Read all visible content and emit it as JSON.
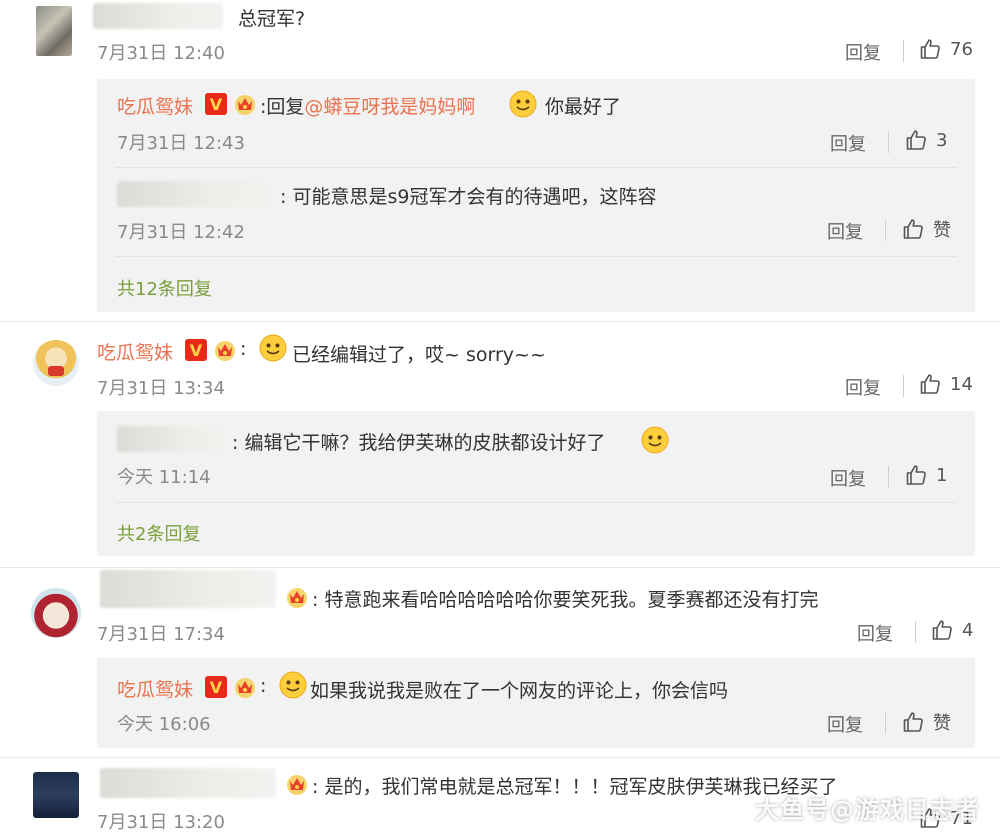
{
  "comments": [
    {
      "text": "总冠军?",
      "time": "7月31日 12:40",
      "reply_label": "回复",
      "likes": "76"
    },
    {
      "user": "吃瓜鸳妹",
      "text": "已经编辑过了，哎~ sorry~~",
      "time": "7月31日 13:34",
      "reply_label": "回复",
      "likes": "14"
    },
    {
      "text": "特意跑来看哈哈哈哈哈哈你要笑死我。夏季赛都还没有打完",
      "time": "7月31日 17:34",
      "reply_label": "回复",
      "likes": "4"
    },
    {
      "text": "是的，我们常电就是总冠军！！！冠军皮肤伊芙琳我已经买了",
      "time": "7月31日 13:20",
      "likes": "71"
    }
  ],
  "replies": [
    {
      "user": "吃瓜鸳妹",
      "text_prefix": "回复",
      "mention": "@蟒豆呀我是妈妈啊",
      "text_suffix": "你最好了",
      "time": "7月31日 12:43",
      "reply_label": "回复",
      "likes": "3"
    },
    {
      "text": "可能意思是s9冠军才会有的待遇吧，这阵容",
      "time": "7月31日 12:42",
      "reply_label": "回复",
      "likes": "赞"
    },
    {
      "text": "编辑它干嘛？我给伊芙琳的皮肤都设计好了",
      "time": "今天 11:14",
      "reply_label": "回复",
      "likes": "1"
    },
    {
      "user": "吃瓜鸳妹",
      "text": "如果我说我是败在了一个网友的评论上，你会信吗",
      "time": "今天 16:06",
      "reply_label": "回复",
      "likes": "赞"
    }
  ],
  "more_replies": [
    "共12条回复",
    "共2条回复"
  ],
  "badges": {
    "verified_letter": "V",
    "colon": ":"
  },
  "watermark": "大鱼号@游戏日志者",
  "colors": {
    "username": "#eb7350",
    "mention": "#eb7350",
    "more_link": "#7a9e3a",
    "panel": "#f2f2f2"
  }
}
